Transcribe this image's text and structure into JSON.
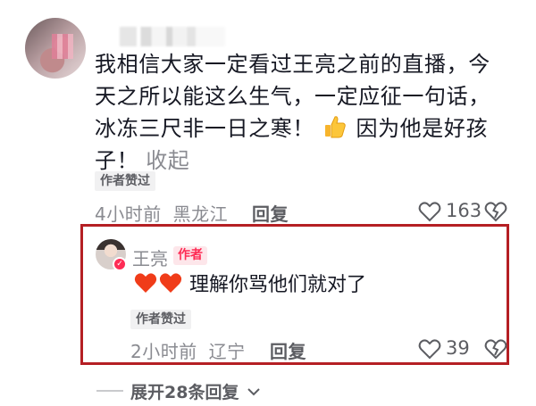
{
  "comment": {
    "text_lines": [
      "我相信大家一定看过王亮之前的直播，今",
      "天之所以能这么生气，一定应征一句话，",
      "冰冻三尺非一日之寒！"
    ],
    "text_after_emoji": "因为他是好孩",
    "text_last_line": "子！",
    "collapse_label": "收起",
    "author_liked_badge": "作者赞过",
    "time": "4小时前",
    "location": "黑龙江",
    "reply_label": "回复",
    "like_count": "163",
    "thumbs_icon": "thumbs-up-emoji"
  },
  "reply": {
    "author_name": "王亮",
    "author_badge": "作者",
    "text": "理解你骂他们就对了",
    "author_liked_badge": "作者赞过",
    "time": "2小时前",
    "location": "辽宁",
    "reply_label": "回复",
    "like_count": "39",
    "highlight_color": "#b51f24"
  },
  "footer": {
    "expand_label": "展开28条回复"
  },
  "colors": {
    "accent": "#fe2c55",
    "meta_gray": "#8a8b91",
    "text": "#161823"
  }
}
